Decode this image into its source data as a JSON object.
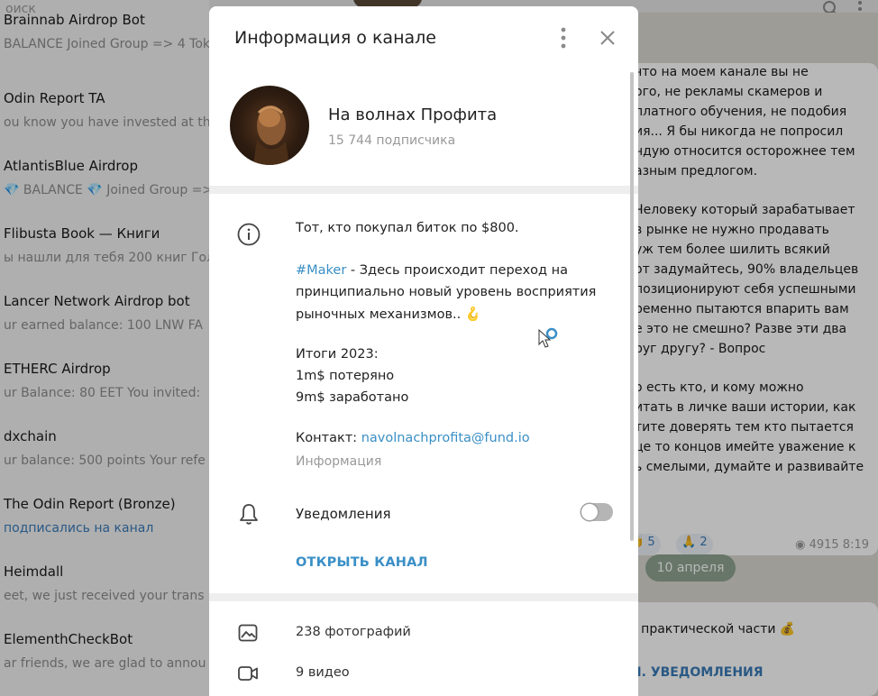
{
  "background": {
    "search_placeholder": "оиск",
    "chats": [
      {
        "title": "Brainnab Airdrop Bot",
        "preview": "BALANCE  Joined Group => 4 Toker"
      },
      {
        "title": "Odin Report TA",
        "preview": "ou know you have invested at th"
      },
      {
        "title": "AtlantisBlue Airdrop",
        "preview": "💎 BALANCE  💎 Joined Group =>"
      },
      {
        "title": "Flibusta Book — Книги",
        "preview": "ы нашли для тебя 200 книг  Гол"
      },
      {
        "title": "Lancer Network Airdrop bot",
        "preview": "ur earned balance: 100 LNW  FA"
      },
      {
        "title": "ETHERC Airdrop",
        "preview": "ur Balance:  80 EET You invited:"
      },
      {
        "title": "dxchain",
        "preview": "ur balance: 500 points Your refe"
      },
      {
        "title": "The Odin Report (Bronze)",
        "preview": "подписались на канал",
        "link": true
      },
      {
        "title": "Heimdall",
        "preview": "eet, we just received your trans"
      },
      {
        "title": "ElementhCheckBot",
        "preview": "ar friends, we are glad to annou"
      }
    ],
    "message_lines": [
      "что на моем канале вы не",
      "ого, не рекламы скамеров и",
      "платного обучения, не подобия",
      "ия... Я бы никогда не попросил",
      "ндую относится осторожнее тем",
      "азным предлогом.",
      "",
      "Человеку который зарабатывает",
      "в рынке не нужно продавать",
      "уж тем более шилить всякий",
      "от задумайтесь, 90% владельцев",
      "позиционируют себя успешными",
      "ременно пытаются впарить вам",
      "е это не смешно? Разве эти два",
      "руг другу? - Вопрос",
      "",
      "о есть кто, и кому можно",
      "итать в личке ваши истории, как",
      "тите доверять тем кто пытается",
      "це то концов имейте уважение к",
      "ь смелыми, думайте и развивайте"
    ],
    "reaction_1": "👏 5",
    "reaction_2": "🙏 2",
    "views": "◉ 4915  8:19",
    "date_pill": "10 апреля",
    "message2_text": ": практической части 💰",
    "message2_button": "Л. УВЕДОМЛЕНИЯ"
  },
  "modal": {
    "title": "Информация о канале",
    "channel_name": "На волнах Профита",
    "subscribers": "15 744 подписчика",
    "info": {
      "line1": "Тот, кто покупал биток по $800.",
      "hashtag": "#Maker",
      "line2_rest": " - Здесь происходит переход на",
      "line3": "принципиально новый уровень восприятия",
      "line4": "рыночных механизмов.. 🪝",
      "line5": "Итоги 2023:",
      "line6": "1m$ потеряно",
      "line7": "9m$ заработано",
      "contact_label": "Контакт: ",
      "contact_email": "navolnachprofita@fund.io",
      "section_label": "Информация"
    },
    "notifications_label": "Уведомления",
    "notifications_on": false,
    "open_channel_label": "ОТКРЫТЬ КАНАЛ",
    "media": {
      "photos": "238 фотографий",
      "videos": "9 видео"
    }
  },
  "colors": {
    "accent": "#3a8fc6",
    "overlay": "rgba(0,0,0,0.28)"
  },
  "icons": [
    "more-vertical-icon",
    "close-icon",
    "info-icon",
    "bell-icon",
    "image-icon",
    "video-icon",
    "search-icon",
    "cursor-icon"
  ]
}
